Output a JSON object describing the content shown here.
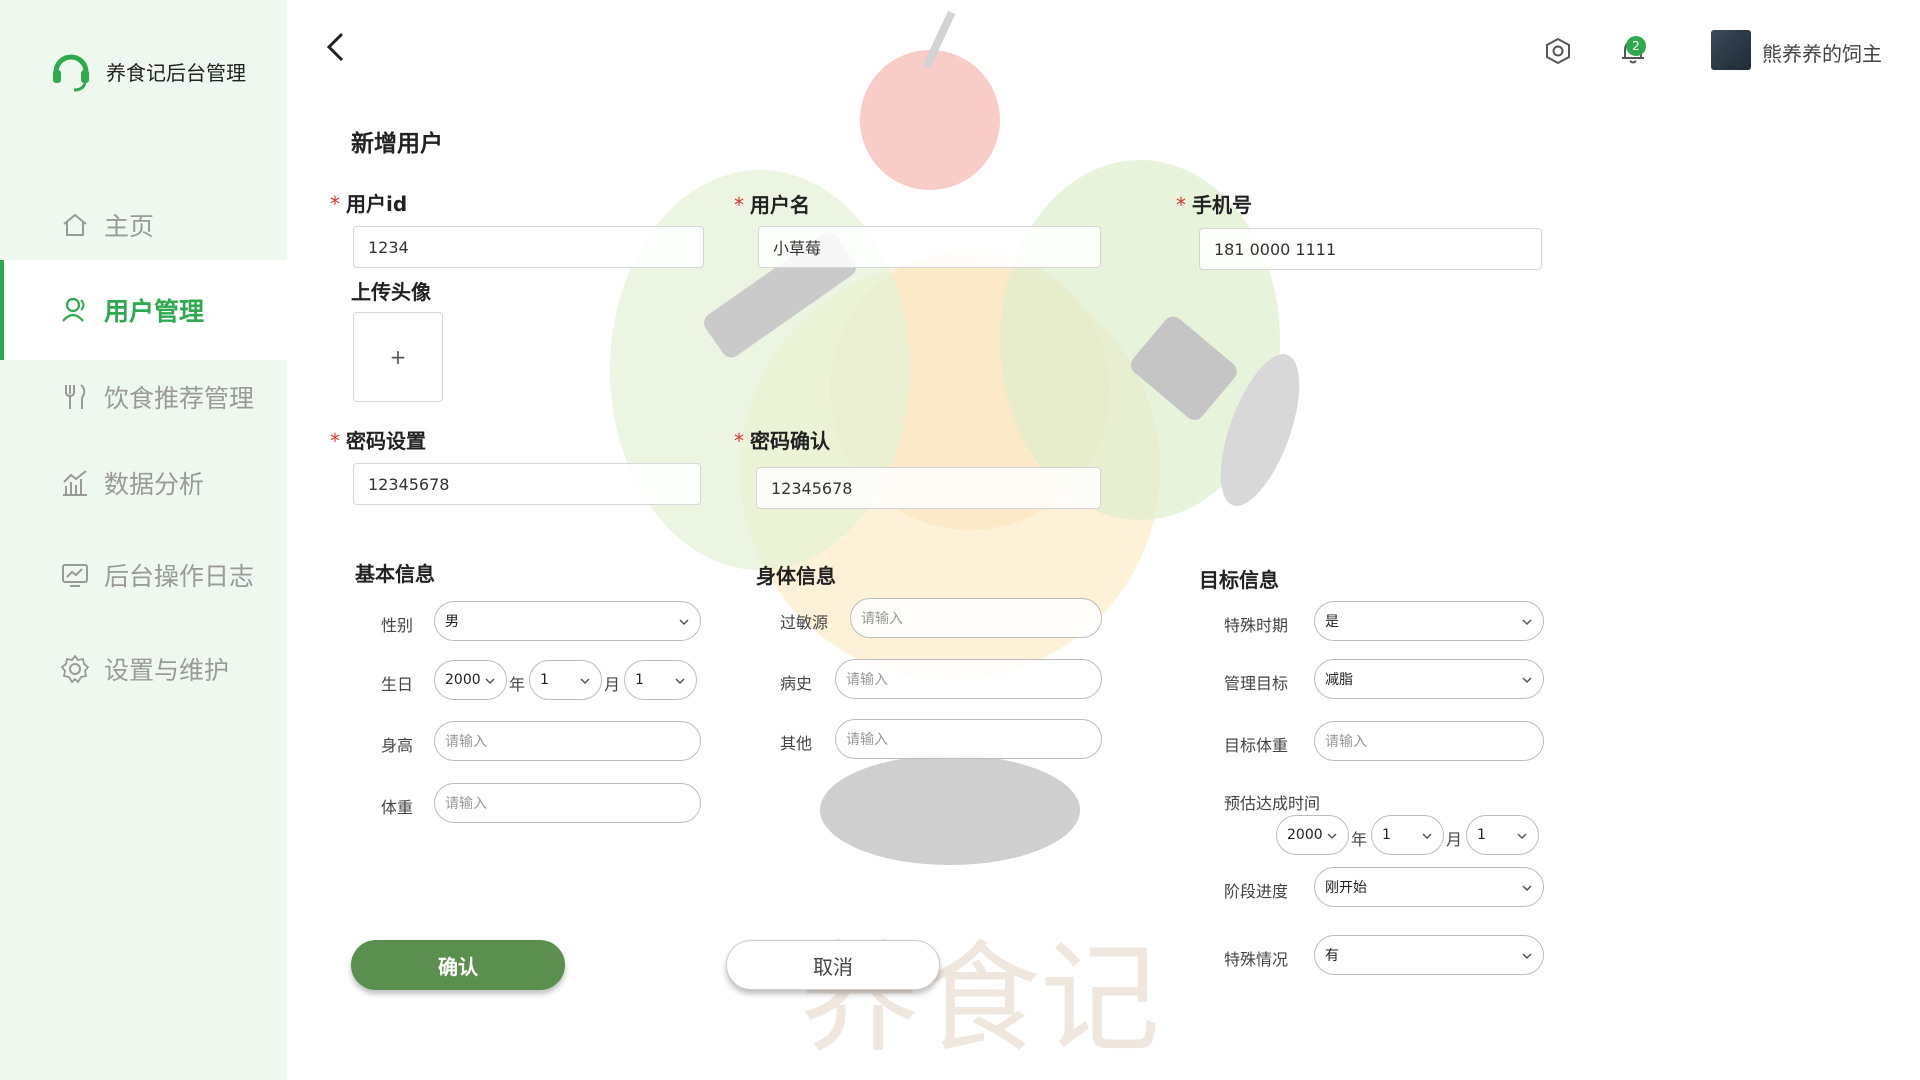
{
  "brand": {
    "name": "养食记后台管理"
  },
  "nav": {
    "home": "主页",
    "users": "用户管理",
    "diet": "饮食推荐管理",
    "analytics": "数据分析",
    "logs": "后台操作日志",
    "settings": "设置与维护"
  },
  "header": {
    "notification_count": "2",
    "username": "熊养养的饲主"
  },
  "page": {
    "title": "新增用户"
  },
  "form": {
    "user_id": {
      "label": "用户id",
      "value": "1234"
    },
    "user_name": {
      "label": "用户名",
      "value": "小草莓"
    },
    "phone": {
      "label": "手机号",
      "value": "181 0000 1111"
    },
    "avatar": {
      "label": "上传头像",
      "plus": "+"
    },
    "password": {
      "label": "密码设置",
      "value": "12345678"
    },
    "password_confirm": {
      "label": "密码确认",
      "value": "12345678"
    },
    "required_mark": "*"
  },
  "basic": {
    "title": "基本信息",
    "gender_label": "性别",
    "gender_value": "男",
    "birthday_label": "生日",
    "birth_year": "2000",
    "year_unit": "年",
    "birth_month": "1",
    "month_unit": "月",
    "birth_day": "1",
    "height_label": "身高",
    "height_placeholder": "请输入",
    "weight_label": "体重",
    "weight_placeholder": "请输入"
  },
  "body": {
    "title": "身体信息",
    "allergen_label": "过敏源",
    "allergen_placeholder": "请输入",
    "history_label": "病史",
    "history_placeholder": "请输入",
    "other_label": "其他",
    "other_placeholder": "请输入"
  },
  "goal": {
    "title": "目标信息",
    "special_period_label": "特殊时期",
    "special_period_value": "是",
    "manage_goal_label": "管理目标",
    "manage_goal_value": "减脂",
    "target_weight_label": "目标体重",
    "target_weight_placeholder": "请输入",
    "eta_label": "预估达成时间",
    "eta_year": "2000",
    "year_unit": "年",
    "eta_month": "1",
    "month_unit": "月",
    "eta_day": "1",
    "stage_label": "阶段进度",
    "stage_value": "刚开始",
    "special_case_label": "特殊情况",
    "special_case_value": "有"
  },
  "actions": {
    "confirm": "确认",
    "cancel": "取消"
  },
  "colors": {
    "accent": "#2fa94e",
    "confirm_button": "#5a8f4f",
    "sidebar_bg": "#eef8ef",
    "required": "#e23333"
  }
}
